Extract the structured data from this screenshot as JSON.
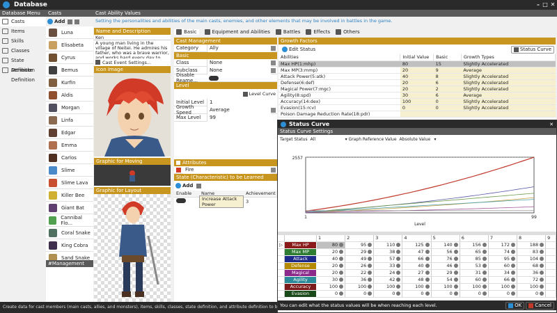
{
  "window": {
    "title": "Database"
  },
  "nav": {
    "header": "Database Menu",
    "items": [
      {
        "label": "Casts",
        "icon": "cast-icon"
      },
      {
        "label": "Items",
        "icon": "item-icon"
      },
      {
        "label": "Skills",
        "icon": "skill-icon"
      },
      {
        "label": "Classes",
        "icon": "class-icon"
      },
      {
        "label": "State Definition",
        "icon": "state-icon"
      },
      {
        "label": "Attribute Definition",
        "icon": "attribute-icon"
      }
    ]
  },
  "casts": {
    "header": "Casts",
    "add_label": "Add",
    "items": [
      "Luna",
      "Elisabeta",
      "Cyrus",
      "Bemus",
      "Kurfin",
      "Aldis",
      "Morgan",
      "Linfa",
      "Edgar",
      "Emma",
      "Carlos",
      "Slime",
      "Slime Lava",
      "Killer Bee",
      "Giant Bat",
      "Cannibal Flo...",
      "Coral Snake",
      "King Cobra",
      "Sand Snake",
      "Goblin"
    ],
    "footer": "#Management Tags"
  },
  "main": {
    "header": "Cast Ability Values",
    "subtitle": "Setting the personalities and abilities of the main casts, enemies, and other elements that may be involved in battles in the game.",
    "name_desc_header": "Name and Description",
    "name": "Ken",
    "description": "A young man living in the village of Neitei. He admires his father, who was a brave warrior, and works hard every day to train himself as a warrior.",
    "event_settings": "Cast Event Settings...",
    "icon_header": "Icon Image",
    "moving_header": "Graphic for Moving",
    "layout_header": "Graphic for Layout"
  },
  "tabs": [
    "Basic",
    "Equipment and Abilities",
    "Battles",
    "Effects",
    "Others"
  ],
  "cast_management": {
    "header": "Cast Management",
    "category_label": "Category",
    "category_value": "Ally",
    "basic_header": "Basic",
    "class_label": "Class",
    "class_value": "None",
    "subclass_label": "Subclass",
    "subclass_value": "None",
    "disable_label": "Disable Reame...",
    "level_header": "Level",
    "level_curve": "Level Curve",
    "initial_level_label": "Initial Level",
    "initial_level_value": "1",
    "growth_speed_label": "Growth Speed",
    "growth_speed_value": "Average",
    "max_level_label": "Max Level",
    "max_level_value": "99"
  },
  "attributes": {
    "header": "Attributes",
    "value": "Fire",
    "state_header": "State (Characteristic) to be Learned",
    "add_label": "Add",
    "cols": [
      "Enable",
      "Name",
      "Achievement"
    ],
    "row": {
      "name": "Increase Attack Power",
      "achievement": "3"
    }
  },
  "growth": {
    "header": "Growth Factors",
    "edit_status": "Edit Status",
    "status_curve": "Status Curve",
    "cols": [
      "Abilities",
      "Initial Value",
      "Basic",
      "Growth Types"
    ],
    "rows": [
      {
        "name": "Max HP(1:mhp)",
        "init": "80",
        "basic": "15",
        "type": "Slightly Accelerated"
      },
      {
        "name": "Max MP(3:mmp)",
        "init": "20",
        "basic": "9",
        "type": "Average"
      },
      {
        "name": "Attack Power(5:atk)",
        "init": "40",
        "basic": "8",
        "type": "Slightly Accelerated"
      },
      {
        "name": "Defense(6:def)",
        "init": "20",
        "basic": "6",
        "type": "Slightly Accelerated"
      },
      {
        "name": "Magical Power(7:mgc)",
        "init": "20",
        "basic": "2",
        "type": "Slightly Accelerated"
      },
      {
        "name": "Agility(8:spd)",
        "init": "30",
        "basic": "6",
        "type": "Average"
      },
      {
        "name": "Accuracy(14:dex)",
        "init": "100",
        "basic": "0",
        "type": "Slightly Accelerated"
      },
      {
        "name": "Evasion(15:rcv)",
        "init": "0",
        "basic": "0",
        "type": "Slightly Accelerated"
      },
      {
        "name": "Poison Damage Reduction Rate(18:pdr)",
        "init": "",
        "basic": "",
        "type": ""
      }
    ]
  },
  "curve": {
    "title": "Status Curve",
    "settings_header": "Status Curve Settings",
    "target_label": "Target Status",
    "target_value": "All",
    "graph_ref_label": "Graph Reference Value",
    "graph_ref_value": "Absolute Value",
    "ymax_label": "2557",
    "xmin_label": "1",
    "xmax_label": "99",
    "xlabel": "Level",
    "col_headers": [
      "1",
      "2",
      "3",
      "4",
      "5",
      "6",
      "7",
      "8",
      "9"
    ],
    "rows": [
      {
        "name": "Max HP",
        "color": "#8b1a1a",
        "vals": [
          "80",
          "95",
          "110",
          "125",
          "140",
          "156",
          "172",
          "188"
        ]
      },
      {
        "name": "Max MP",
        "color": "#2e7d32",
        "vals": [
          "20",
          "29",
          "38",
          "47",
          "56",
          "65",
          "74",
          "83"
        ]
      },
      {
        "name": "Attack",
        "color": "#1e2a8a",
        "vals": [
          "40",
          "49",
          "57",
          "66",
          "76",
          "85",
          "95",
          "104"
        ]
      },
      {
        "name": "Defense",
        "color": "#b58a00",
        "vals": [
          "20",
          "26",
          "33",
          "40",
          "46",
          "53",
          "60",
          "68"
        ]
      },
      {
        "name": "Magical",
        "color": "#8b2a8b",
        "vals": [
          "20",
          "22",
          "24",
          "27",
          "29",
          "31",
          "34",
          "36"
        ]
      },
      {
        "name": "Agility",
        "color": "#2a8a9a",
        "vals": [
          "30",
          "36",
          "42",
          "48",
          "54",
          "60",
          "66",
          "72"
        ]
      },
      {
        "name": "Accuracy",
        "color": "#7a1a1a",
        "vals": [
          "100",
          "100",
          "100",
          "100",
          "100",
          "100",
          "100",
          "100"
        ]
      },
      {
        "name": "Evasion",
        "color": "#1a4a1a",
        "vals": [
          "0",
          "0",
          "0",
          "0",
          "0",
          "0",
          "0",
          "0"
        ]
      }
    ],
    "footer": "You can edit what the status values will be when reaching each level.",
    "ok": "OK",
    "cancel": "Cancel"
  },
  "status_bar": "Create data for cast members (main casts, allies, and monsters), items, skills, classes, state definition, and attribute definition to be used in the game.",
  "chart_data": {
    "type": "line",
    "xlabel": "Level",
    "xlim": [
      1,
      99
    ],
    "ylim": [
      0,
      2557
    ],
    "series": [
      {
        "name": "Max HP",
        "color": "#c0392b",
        "x": [
          1,
          99
        ],
        "y": [
          80,
          2557
        ],
        "curve": "accelerated"
      },
      {
        "name": "Attack",
        "color": "#5a5aa8",
        "x": [
          1,
          99
        ],
        "y": [
          40,
          1200
        ],
        "curve": "accelerated"
      },
      {
        "name": "Max MP",
        "color": "#6a9a4a",
        "x": [
          1,
          99
        ],
        "y": [
          20,
          900
        ],
        "curve": "linear"
      },
      {
        "name": "Defense",
        "color": "#c8a040",
        "x": [
          1,
          99
        ],
        "y": [
          20,
          700
        ],
        "curve": "accelerated"
      },
      {
        "name": "Agility",
        "color": "#4aa0a8",
        "x": [
          1,
          99
        ],
        "y": [
          30,
          620
        ],
        "curve": "linear"
      },
      {
        "name": "Magical",
        "color": "#a05aa0",
        "x": [
          1,
          99
        ],
        "y": [
          20,
          280
        ],
        "curve": "accelerated"
      },
      {
        "name": "Accuracy",
        "color": "#888888",
        "x": [
          1,
          99
        ],
        "y": [
          100,
          100
        ],
        "curve": "linear"
      }
    ]
  }
}
